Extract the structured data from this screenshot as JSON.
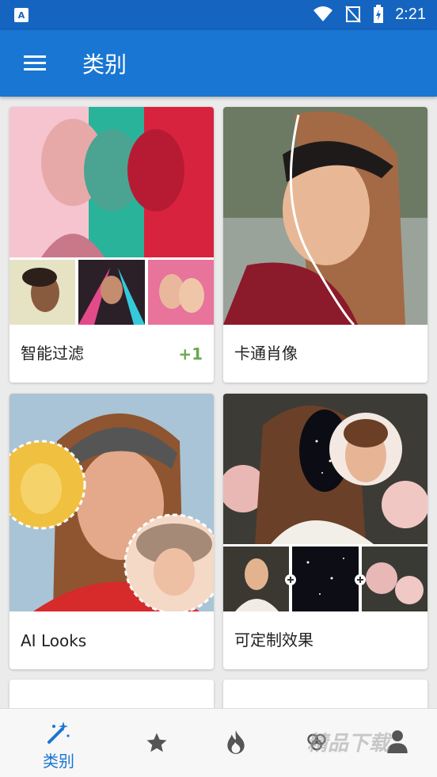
{
  "status_bar": {
    "time": "2:21"
  },
  "app_bar": {
    "title": "类别"
  },
  "cards": [
    {
      "label": "智能过滤",
      "badge": "+1"
    },
    {
      "label": "卡通肖像"
    },
    {
      "label": "AI Looks"
    },
    {
      "label": "可定制效果"
    }
  ],
  "bottom_nav": {
    "active_label": "类别",
    "items": [
      "categories-icon",
      "star-icon",
      "flame-icon",
      "clover-icon",
      "person-icon"
    ]
  },
  "watermark": {
    "text": "精品下载"
  },
  "colors": {
    "primary": "#1976d2",
    "statusbar": "#1565c0",
    "badge": "#6aa84f"
  }
}
